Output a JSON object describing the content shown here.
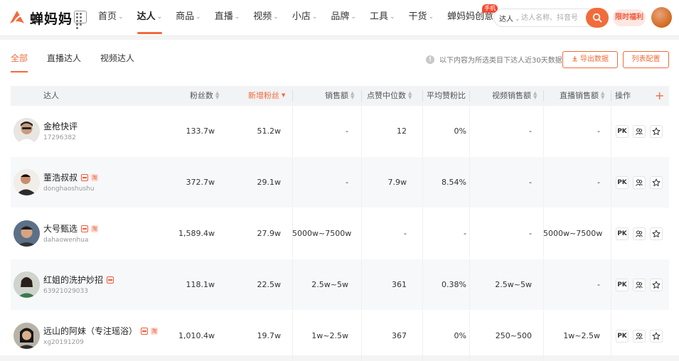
{
  "brand": {
    "name": "蝉妈妈",
    "accent": "#f26b3a"
  },
  "nav": [
    {
      "label": "首页",
      "caret": true,
      "active": false
    },
    {
      "label": "达人",
      "caret": true,
      "active": true
    },
    {
      "label": "商品",
      "caret": true,
      "active": false
    },
    {
      "label": "直播",
      "caret": true,
      "active": false
    },
    {
      "label": "视频",
      "caret": true,
      "active": false
    },
    {
      "label": "小店",
      "caret": true,
      "active": false
    },
    {
      "label": "品牌",
      "caret": true,
      "active": false
    },
    {
      "label": "工具",
      "caret": true,
      "active": false
    },
    {
      "label": "干货",
      "caret": true,
      "active": false
    },
    {
      "label": "蝉妈妈创意",
      "caret": false,
      "active": false,
      "badge": "手机"
    }
  ],
  "search": {
    "type": "达人",
    "placeholder": "达人名称、抖音号"
  },
  "promo": "限时福利",
  "tabs": [
    "全部",
    "直播达人",
    "视频达人"
  ],
  "notice": "以下内容为所选类目下达人近30天数据",
  "actions": {
    "export": "导出数据",
    "config": "列表配置"
  },
  "columns": {
    "creator": "达人",
    "fans": "粉丝数",
    "new_fans": "新增粉丝",
    "sales": "销售额",
    "likes_median": "点赞中位数",
    "avg_like_ratio": "平均赞粉比",
    "video_sales": "视频销售额",
    "live_sales": "直播销售额",
    "ops": "操作"
  },
  "rows": [
    {
      "name": "金枪快评",
      "handle": "17296382",
      "tags": [],
      "fans": "133.7w",
      "new_fans": "51.2w",
      "sales": "-",
      "likes_median": "12",
      "avg_like_ratio": "0%",
      "video_sales": "-",
      "live_sales": "-"
    },
    {
      "name": "董浩叔叔",
      "handle": "donghaoshushu",
      "tags": [
        "store",
        "tb"
      ],
      "fans": "372.7w",
      "new_fans": "29.1w",
      "sales": "-",
      "likes_median": "7.9w",
      "avg_like_ratio": "8.54%",
      "video_sales": "-",
      "live_sales": "-"
    },
    {
      "name": "大号甄选",
      "handle": "dahaowenhua",
      "tags": [
        "store",
        "tb"
      ],
      "fans": "1,589.4w",
      "new_fans": "27.9w",
      "sales": "5000w~7500w",
      "likes_median": "-",
      "avg_like_ratio": "-",
      "video_sales": "-",
      "live_sales": "5000w~7500w"
    },
    {
      "name": "红姐的洗护妙招",
      "handle": "63921029033",
      "tags": [
        "store"
      ],
      "fans": "118.1w",
      "new_fans": "22.5w",
      "sales": "2.5w~5w",
      "likes_median": "361",
      "avg_like_ratio": "0.38%",
      "video_sales": "2.5w~5w",
      "live_sales": "-"
    },
    {
      "name": "远山的阿妹（专注瑶浴）",
      "handle": "xg20191209",
      "tags": [
        "store",
        "tb"
      ],
      "fans": "1,010.4w",
      "new_fans": "19.7w",
      "sales": "1w~2.5w",
      "likes_median": "367",
      "avg_like_ratio": "0%",
      "video_sales": "250~500",
      "live_sales": "1w~2.5w"
    }
  ],
  "row_ops": {
    "pk": "PK"
  }
}
